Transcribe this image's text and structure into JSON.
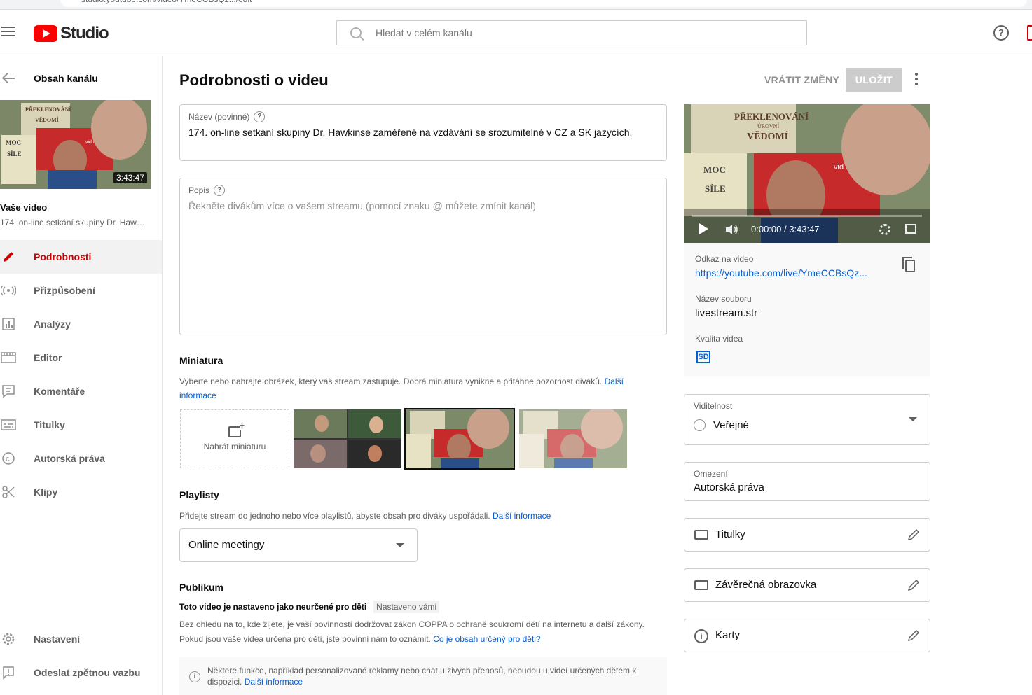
{
  "browser": {
    "url": "studio.youtube.com/video/YmeCCBsQz.../edit"
  },
  "header": {
    "logo_text": "Studio",
    "search_placeholder": "Hledat v celém kanálu"
  },
  "sidebar": {
    "back_label": "Obsah kanálu",
    "thumb_duration": "3:43:47",
    "your_video_label": "Vaše video",
    "video_title_short": "174. on-line setkání skupiny Dr. Hawkinse zaměřené na vzdávání se srozumitelné v CZ a SK jazycích.",
    "items": [
      {
        "label": "Podrobnosti",
        "icon": "pencil-icon",
        "active": true
      },
      {
        "label": "Přizpůsobení",
        "icon": "broadcast-icon",
        "active": false
      },
      {
        "label": "Analýzy",
        "icon": "analytics-icon",
        "active": false
      },
      {
        "label": "Editor",
        "icon": "film-icon",
        "active": false
      },
      {
        "label": "Komentáře",
        "icon": "comments-icon",
        "active": false
      },
      {
        "label": "Titulky",
        "icon": "subtitles-icon",
        "active": false
      },
      {
        "label": "Autorská práva",
        "icon": "copyright-icon",
        "active": false
      },
      {
        "label": "Klipy",
        "icon": "scissors-icon",
        "active": false
      }
    ],
    "bottom_items": [
      {
        "label": "Nastavení",
        "icon": "gear-icon"
      },
      {
        "label": "Odeslat zpětnou vazbu",
        "icon": "feedback-icon"
      }
    ]
  },
  "main": {
    "page_title": "Podrobnosti o videu",
    "revert_label": "VRÁTIT ZMĚNY",
    "save_label": "ULOŽIT",
    "title_field": {
      "label": "Název (povinné)",
      "value": "174. on-line setkání skupiny Dr. Hawkinse zaměřené na vzdávání se srozumitelné v CZ a SK jazycích."
    },
    "description_field": {
      "label": "Popis",
      "placeholder": "Řekněte divákům více o vašem streamu (pomocí znaku @ můžete zmínit kanál)"
    },
    "thumbnail": {
      "title": "Miniatura",
      "desc": "Vyberte nebo nahrajte obrázek, který váš stream zastupuje. Dobrá miniatura vynikne a přitáhne pozornost diváků.",
      "link": "Další informace",
      "upload_label": "Nahrát miniaturu"
    },
    "playlists": {
      "title": "Playlisty",
      "desc": "Přidejte stream do jednoho nebo více playlistů, abyste obsah pro diváky uspořádali.",
      "link": "Další informace",
      "selected": "Online meetingy"
    },
    "audience": {
      "title": "Publikum",
      "setting": "Toto video je nastaveno jako neurčené pro děti",
      "chip": "Nastaveno vámi",
      "desc": "Bez ohledu na to, kde žijete, je vaší povinností dodržovat zákon COPPA o ochraně soukromí dětí na internetu a další zákony. Pokud jsou vaše videa určena pro děti, jste povinni nám to oznámit.",
      "link": "Co je obsah určený pro děti?",
      "info": "Některé funkce, například personalizované reklamy nebo chat u živých přenosů, nebudou u videí určených dětem k dispozici.",
      "info_link": "Další informace"
    }
  },
  "right": {
    "player_time": "0:00:00 / 3:43:47",
    "video_link_label": "Odkaz na video",
    "video_link": "https://youtube.com/live/YmeCCBsQz...",
    "filename_label": "Název souboru",
    "filename": "livestream.str",
    "quality_label": "Kvalita videa",
    "quality_badge": "SD",
    "visibility_label": "Viditelnost",
    "visibility_value": "Veřejné",
    "restriction_label": "Omezení",
    "restriction_value": "Autorská práva",
    "cards": [
      {
        "label": "Titulky"
      },
      {
        "label": "Závěrečná obrazovka"
      },
      {
        "label": "Karty"
      }
    ]
  },
  "thumb_text": {
    "book1_title": "PŘEKLENOVÁNÍ",
    "book1_sub": "ÚROVNÍ",
    "book1_sub2": "VĚDOMÍ",
    "book2_title": "MOC",
    "book2_sub": "SÍLE",
    "author": "vid R. Hawkins, M.D., Ph.D."
  }
}
